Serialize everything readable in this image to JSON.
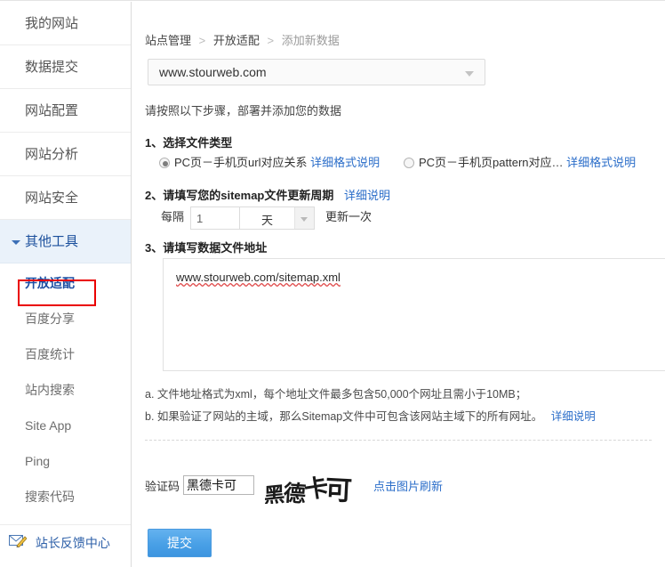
{
  "sidebar": {
    "top_items": [
      {
        "label": "我的网站"
      },
      {
        "label": "数据提交"
      },
      {
        "label": "网站配置"
      },
      {
        "label": "网站分析"
      },
      {
        "label": "网站安全"
      }
    ],
    "expanded_group": "其他工具",
    "sub_items": [
      {
        "label": "开放适配",
        "active": true
      },
      {
        "label": "百度分享",
        "active": false
      },
      {
        "label": "百度统计",
        "active": false
      },
      {
        "label": "站内搜索",
        "active": false
      },
      {
        "label": "Site App",
        "active": false
      },
      {
        "label": "Ping",
        "active": false
      },
      {
        "label": "搜索代码",
        "active": false
      }
    ],
    "feedback_label": "站长反馈中心",
    "feedback_icon": "mail-pencil-icon",
    "highlight_color": "#ea0000",
    "active_color": "#1d4ea3"
  },
  "breadcrumb": {
    "items": [
      "站点管理",
      "开放适配",
      "添加新数据"
    ],
    "separator": ">"
  },
  "site_select": {
    "value": "www.stourweb.com",
    "icon": "chevron-down-icon"
  },
  "intro": "请按照以下步骤，部署并添加您的数据",
  "step1": {
    "title": "1、选择文件类型",
    "options": [
      {
        "label": "PC页－手机页url对应关系",
        "link": "详细格式说明",
        "checked": true
      },
      {
        "label": "PC页－手机页pattern对应…",
        "link": "详细格式说明",
        "checked": false
      }
    ]
  },
  "step2": {
    "title": "2、请填写您的sitemap文件更新周期",
    "link": "详细说明",
    "prefix": "每隔",
    "value": "1",
    "unit": "天",
    "unit_icon": "chevron-down-icon",
    "suffix": "更新一次"
  },
  "step3": {
    "title": "3、请填写数据文件地址",
    "value": "www.stourweb.com/sitemap.xml"
  },
  "notes": {
    "a": "a. 文件地址格式为xml，每个地址文件最多包含50,000个网址且需小于10MB；",
    "b_text": "b. 如果验证了网站的主域，那么Sitemap文件中可包含该网站主域下的所有网址。",
    "b_link": "详细说明"
  },
  "captcha": {
    "label": "验证码",
    "value": "黑德卡可",
    "image_text": "黑德卡可",
    "refresh_label": "点击图片刷新"
  },
  "submit": {
    "label": "提交"
  },
  "colors": {
    "link": "#2a6dc9",
    "accent": "#3d95e0",
    "border": "#dcdcdc"
  }
}
